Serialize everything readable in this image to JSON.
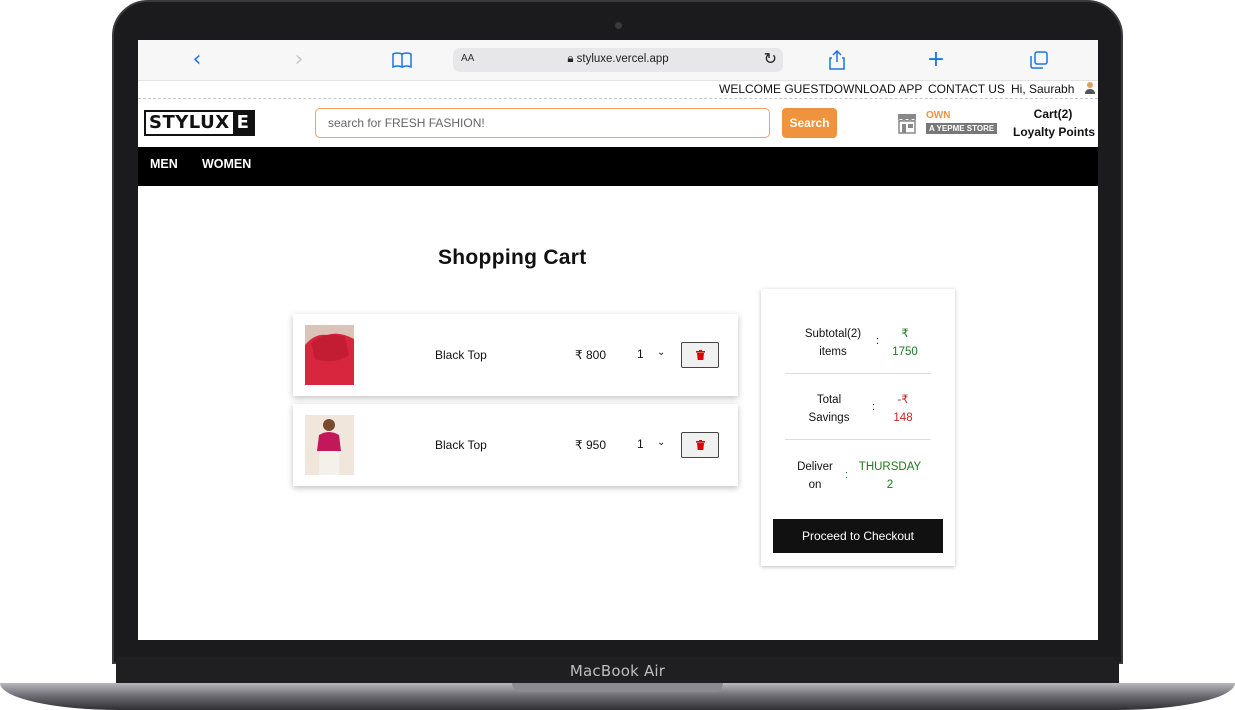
{
  "device": {
    "label": "MacBook Air"
  },
  "browser": {
    "aa_label": "AA",
    "url": "styluxe.vercel.app",
    "icons": [
      "back-icon",
      "forward-icon",
      "bookmarks-icon",
      "lock-icon",
      "reload-icon",
      "share-icon",
      "new-tab-icon",
      "tabs-icon"
    ]
  },
  "top_strip": {
    "welcome": "WELCOME GUEST",
    "download": "DOWNLOAD APP",
    "contact": "CONTACT US",
    "greeting": "Hi, Saurabh"
  },
  "header": {
    "logo_main": "STYLUX",
    "logo_box": "E",
    "search_placeholder": "search for FRESH FASHION!",
    "search_button": "Search",
    "own_label": "OWN",
    "store_label": "A YEPME STORE",
    "cart_label": "Cart(2)",
    "loyalty_label": "Loyalty Points"
  },
  "nav": {
    "items": [
      "MEN",
      "WOMEN"
    ]
  },
  "cart": {
    "title": "Shopping Cart",
    "items": [
      {
        "name": "Black Top",
        "price": "₹ 800",
        "qty": "1"
      },
      {
        "name": "Black Top",
        "price": "₹ 950",
        "qty": "1"
      }
    ]
  },
  "summary": {
    "subtotal_label_1": "Subtotal(2)",
    "subtotal_label_2": "items",
    "subtotal_val_1": "₹",
    "subtotal_val_2": "1750",
    "savings_label_1": "Total",
    "savings_label_2": "Savings",
    "savings_val_1": "-₹",
    "savings_val_2": "148",
    "deliver_label_1": "Deliver",
    "deliver_label_2": "on",
    "deliver_val_1": "THURSDAY",
    "deliver_val_2": "2",
    "colon": ":",
    "checkout": "Proceed to Checkout"
  },
  "colors": {
    "accent": "#f0933e",
    "positive": "#1a7a1a",
    "negative": "#cc2222",
    "nav_bg": "#000000"
  }
}
